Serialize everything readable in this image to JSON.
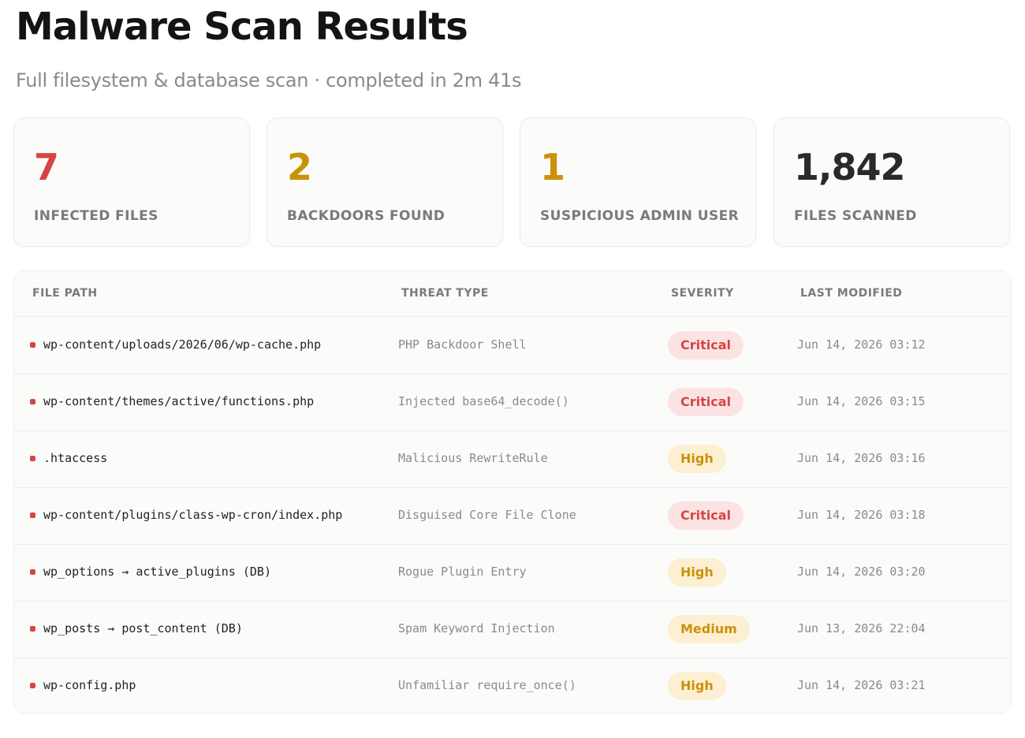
{
  "header": {
    "title": "Malware Scan Results",
    "subtitle": "Full filesystem & database scan · completed in 2m 41s"
  },
  "stats": [
    {
      "value": "7",
      "label": "INFECTED FILES",
      "color": "#d64545"
    },
    {
      "value": "2",
      "label": "BACKDOORS FOUND",
      "color": "#c9920a"
    },
    {
      "value": "1",
      "label": "SUSPICIOUS ADMIN USER",
      "color": "#c9920a"
    },
    {
      "value": "1,842",
      "label": "FILES SCANNED",
      "color": "#2a2a2a"
    }
  ],
  "table": {
    "columns": {
      "path": "FILE PATH",
      "threat": "THREAT TYPE",
      "severity": "SEVERITY",
      "modified": "LAST MODIFIED"
    },
    "rows": [
      {
        "path": "wp-content/uploads/2026/06/wp-cache.php",
        "threat": "PHP Backdoor Shell",
        "severity": "Critical",
        "modified": "Jun 14, 2026 03:12"
      },
      {
        "path": "wp-content/themes/active/functions.php",
        "threat": "Injected base64_decode()",
        "severity": "Critical",
        "modified": "Jun 14, 2026 03:15"
      },
      {
        "path": ".htaccess",
        "threat": "Malicious RewriteRule",
        "severity": "High",
        "modified": "Jun 14, 2026 03:16"
      },
      {
        "path": "wp-content/plugins/class-wp-cron/index.php",
        "threat": "Disguised Core File Clone",
        "severity": "Critical",
        "modified": "Jun 14, 2026 03:18"
      },
      {
        "path": "wp_options → active_plugins (DB)",
        "threat": "Rogue Plugin Entry",
        "severity": "High",
        "modified": "Jun 14, 2026 03:20"
      },
      {
        "path": "wp_posts → post_content (DB)",
        "threat": "Spam Keyword Injection",
        "severity": "Medium",
        "modified": "Jun 13, 2026 22:04"
      },
      {
        "path": "wp-config.php",
        "threat": "Unfamiliar require_once()",
        "severity": "High",
        "modified": "Jun 14, 2026 03:21"
      }
    ]
  }
}
